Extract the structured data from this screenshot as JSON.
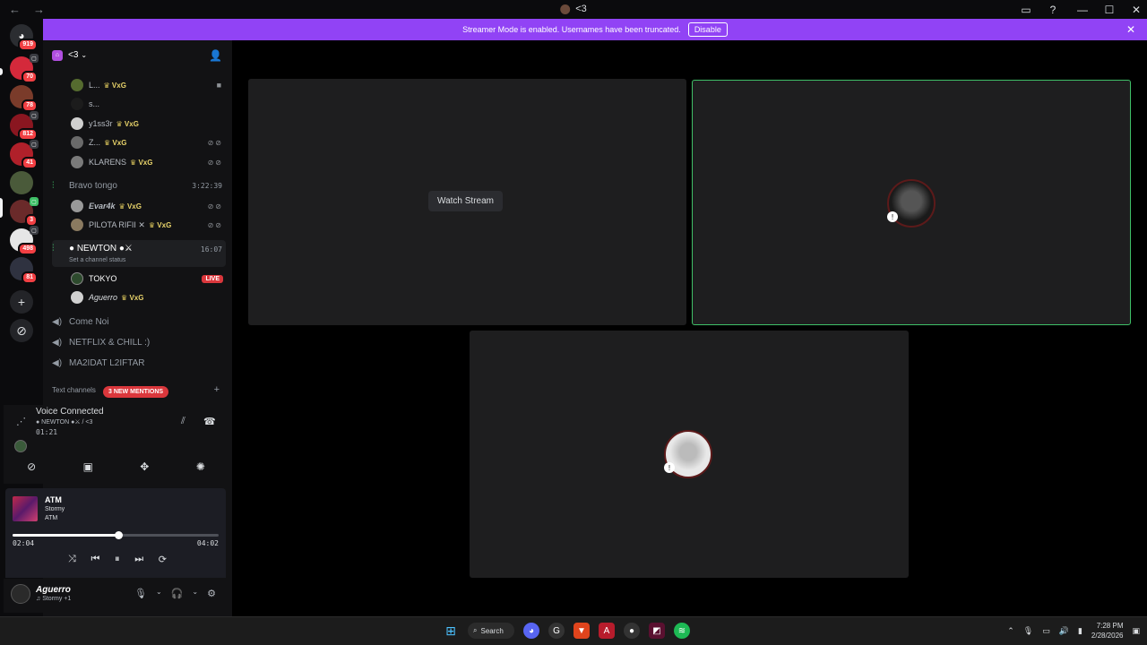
{
  "titlebar": {
    "title": "<3",
    "back_icon": "back-arrow-icon",
    "forward_icon": "forward-arrow-icon"
  },
  "guilds": {
    "badges": [
      "919",
      "70",
      "78",
      "812",
      "41",
      "3",
      "498",
      "81"
    ]
  },
  "banner": {
    "message": "Streamer Mode is enabled. Usernames have been truncated.",
    "button_label": "Disable",
    "color": "#9143f5"
  },
  "server": {
    "name": "<3"
  },
  "voice_members_top": [
    {
      "name": "L...",
      "tag": "VxG",
      "icons": "video"
    },
    {
      "name": "s...",
      "tag": ""
    },
    {
      "name": "y1ss3r",
      "tag": "VxG"
    },
    {
      "name": "Z...",
      "tag": "VxG",
      "icons": "deafened"
    },
    {
      "name": "KLARENS",
      "tag": "VxG",
      "icons": "deafened"
    }
  ],
  "channels": {
    "bravo": {
      "name": "Bravo tongo",
      "time": "3:22:39"
    },
    "bravo_members": [
      {
        "name": "Evar4k",
        "tag": "VxG"
      },
      {
        "name": "PILOTA RIFII ✕",
        "tag": "VxG"
      }
    ],
    "newton": {
      "name": "● NEWTON ●⚔",
      "time": "16:07",
      "status": "Set a channel status"
    },
    "newton_members": [
      {
        "name": "TOKYO",
        "live": "LIVE"
      },
      {
        "name": "Aguerro",
        "tag": "VxG"
      }
    ],
    "others": [
      "Come Noi",
      "NETFLIX & CHILL :)",
      "MA2IDAT L2IFTAR"
    ],
    "text_header": "Text channels",
    "mentions": "3 NEW MENTIONS"
  },
  "voice_connected": {
    "title": "Voice Connected",
    "channel": "● NEWTON ●⚔ / <3",
    "elapsed": "01:21"
  },
  "now_playing": {
    "title": "ATM",
    "artist": "Stormy",
    "album": "ATM",
    "current": "02:04",
    "duration": "04:02",
    "progress_fraction": 0.513
  },
  "user": {
    "name": "Aguerro",
    "status": "♫ Stormy +1"
  },
  "stage": {
    "watch_label": "Watch Stream",
    "speaking_color": "#3fbf67"
  },
  "taskbar": {
    "search_label": "Search",
    "time": "7:28 PM",
    "date": "2/28/2026"
  }
}
